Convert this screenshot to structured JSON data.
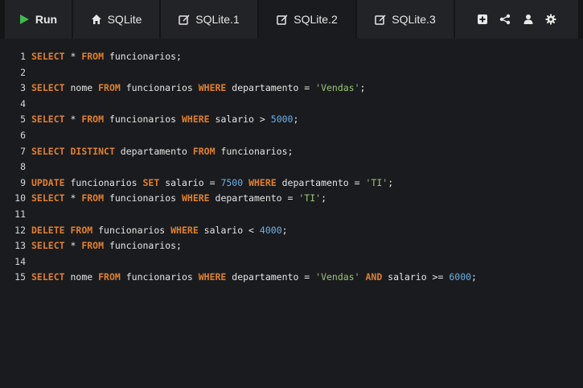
{
  "toolbar": {
    "run_label": "Run",
    "tabs": [
      {
        "label": "SQLite",
        "icon": "home-icon"
      },
      {
        "label": "SQLite.1",
        "icon": "edit-icon"
      },
      {
        "label": "SQLite.2",
        "icon": "edit-icon"
      },
      {
        "label": "SQLite.3",
        "icon": "edit-icon"
      }
    ],
    "active_tab": "SQLite.2",
    "actions": [
      "add-icon",
      "share-icon",
      "user-icon",
      "gear-icon"
    ]
  },
  "colors": {
    "keyword": "#e0802f",
    "string": "#9dc47a",
    "number": "#6cb0e8",
    "run_icon": "#3fb950"
  },
  "editor": {
    "lines": [
      {
        "n": "1",
        "tokens": [
          [
            "kw",
            "SELECT"
          ],
          [
            "txt",
            " * "
          ],
          [
            "kw",
            "FROM"
          ],
          [
            "txt",
            " funcionarios;"
          ]
        ]
      },
      {
        "n": "2",
        "tokens": []
      },
      {
        "n": "3",
        "tokens": [
          [
            "kw",
            "SELECT"
          ],
          [
            "txt",
            " nome "
          ],
          [
            "kw",
            "FROM"
          ],
          [
            "txt",
            " funcionarios "
          ],
          [
            "kw",
            "WHERE"
          ],
          [
            "txt",
            " departamento = "
          ],
          [
            "str",
            "'Vendas'"
          ],
          [
            "txt",
            ";"
          ]
        ]
      },
      {
        "n": "4",
        "tokens": []
      },
      {
        "n": "5",
        "tokens": [
          [
            "kw",
            "SELECT"
          ],
          [
            "txt",
            " * "
          ],
          [
            "kw",
            "FROM"
          ],
          [
            "txt",
            " funcionarios "
          ],
          [
            "kw",
            "WHERE"
          ],
          [
            "txt",
            " salario > "
          ],
          [
            "num",
            "5000"
          ],
          [
            "txt",
            ";"
          ]
        ]
      },
      {
        "n": "6",
        "tokens": []
      },
      {
        "n": "7",
        "tokens": [
          [
            "kw",
            "SELECT"
          ],
          [
            "txt",
            " "
          ],
          [
            "kw",
            "DISTINCT"
          ],
          [
            "txt",
            " departamento "
          ],
          [
            "kw",
            "FROM"
          ],
          [
            "txt",
            " funcionarios;"
          ]
        ]
      },
      {
        "n": "8",
        "tokens": []
      },
      {
        "n": "9",
        "tokens": [
          [
            "kw",
            "UPDATE"
          ],
          [
            "txt",
            " funcionarios "
          ],
          [
            "kw",
            "SET"
          ],
          [
            "txt",
            " salario = "
          ],
          [
            "num",
            "7500"
          ],
          [
            "txt",
            " "
          ],
          [
            "kw",
            "WHERE"
          ],
          [
            "txt",
            " departamento = "
          ],
          [
            "str",
            "'TI'"
          ],
          [
            "txt",
            ";"
          ]
        ]
      },
      {
        "n": "10",
        "tokens": [
          [
            "kw",
            "SELECT"
          ],
          [
            "txt",
            " * "
          ],
          [
            "kw",
            "FROM"
          ],
          [
            "txt",
            " funcionarios "
          ],
          [
            "kw",
            "WHERE"
          ],
          [
            "txt",
            " departamento = "
          ],
          [
            "str",
            "'TI'"
          ],
          [
            "txt",
            ";"
          ]
        ]
      },
      {
        "n": "11",
        "tokens": []
      },
      {
        "n": "12",
        "tokens": [
          [
            "kw",
            "DELETE"
          ],
          [
            "txt",
            " "
          ],
          [
            "kw",
            "FROM"
          ],
          [
            "txt",
            " funcionarios "
          ],
          [
            "kw",
            "WHERE"
          ],
          [
            "txt",
            " salario < "
          ],
          [
            "num",
            "4000"
          ],
          [
            "txt",
            ";"
          ]
        ]
      },
      {
        "n": "13",
        "tokens": [
          [
            "kw",
            "SELECT"
          ],
          [
            "txt",
            " * "
          ],
          [
            "kw",
            "FROM"
          ],
          [
            "txt",
            " funcionarios;"
          ]
        ]
      },
      {
        "n": "14",
        "tokens": []
      },
      {
        "n": "15",
        "tokens": [
          [
            "kw",
            "SELECT"
          ],
          [
            "txt",
            " nome "
          ],
          [
            "kw",
            "FROM"
          ],
          [
            "txt",
            " funcionarios "
          ],
          [
            "kw",
            "WHERE"
          ],
          [
            "txt",
            " departamento = "
          ],
          [
            "str",
            "'Vendas'"
          ],
          [
            "txt",
            " "
          ],
          [
            "kw",
            "AND"
          ],
          [
            "txt",
            " salario >= "
          ],
          [
            "num",
            "6000"
          ],
          [
            "txt",
            ";"
          ]
        ]
      }
    ]
  }
}
